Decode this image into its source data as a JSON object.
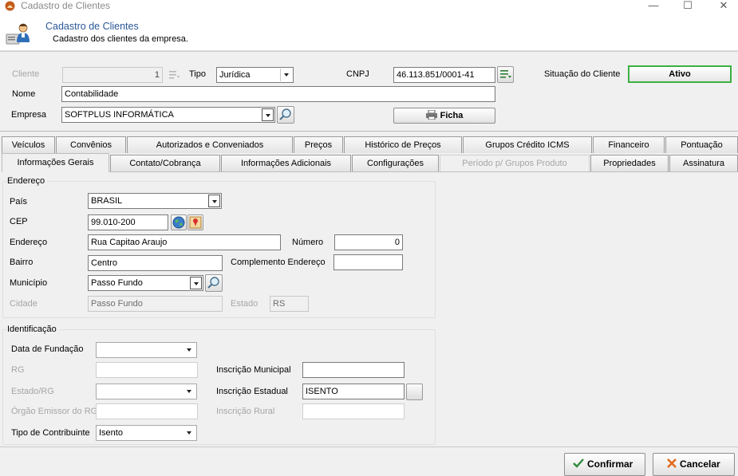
{
  "window": {
    "title": "Cadastro de Clientes",
    "minimize_label": "—",
    "maximize_label": "☐",
    "close_label": "✕"
  },
  "header": {
    "title": "Cadastro de Clientes",
    "subtitle": "Cadastro dos clientes da empresa."
  },
  "form": {
    "cliente_label": "Cliente",
    "cliente_value": "1",
    "tipo_label": "Tipo",
    "tipo_value": "Jurídica",
    "cnpj_label": "CNPJ",
    "cnpj_value": "46.113.851/0001-41",
    "situacao_label": "Situação do Cliente",
    "situacao_value": "Ativo",
    "nome_label": "Nome",
    "nome_value": "Contabilidade",
    "empresa_label": "Empresa",
    "empresa_value": "SOFTPLUS INFORMÁTICA",
    "ficha_label": "Ficha"
  },
  "tabs_row1": [
    "Veículos",
    "Convênios",
    "Autorizados e Conveniados",
    "Preços",
    "Histórico de Preços",
    "Grupos Crédito ICMS",
    "Financeiro",
    "Pontuação"
  ],
  "tabs_row2": [
    "Informações Gerais",
    "Contato/Cobrança",
    "Informações Adicionais",
    "Configurações",
    "Período p/ Grupos Produto",
    "Propriedades",
    "Assinatura"
  ],
  "endereco": {
    "group_label": "Endereço",
    "pais_label": "País",
    "pais_value": "BRASIL",
    "cep_label": "CEP",
    "cep_value": "99.010-200",
    "endereco_label": "Endereço",
    "endereco_value": "Rua Capitao Araujo",
    "numero_label": "Número",
    "numero_value": "0",
    "bairro_label": "Bairro",
    "bairro_value": "Centro",
    "complemento_label": "Complemento Endereço",
    "complemento_value": "",
    "municipio_label": "Município",
    "municipio_value": "Passo Fundo",
    "cidade_label": "Cidade",
    "cidade_value": "Passo Fundo",
    "estado_label": "Estado",
    "estado_value": "RS"
  },
  "identificacao": {
    "group_label": "Identificação",
    "fundacao_label": "Data de Fundação",
    "fundacao_value": "",
    "rg_label": "RG",
    "rg_value": "",
    "insc_municipal_label": "Inscrição Municipal",
    "insc_municipal_value": "",
    "estado_rg_label": "Estado/RG",
    "estado_rg_value": "",
    "insc_estadual_label": "Inscrição Estadual",
    "insc_estadual_value": "ISENTO",
    "orgao_label": "Órgão Emissor do RG",
    "orgao_value": "",
    "insc_rural_label": "Inscrição Rural",
    "insc_rural_value": "",
    "tipo_contrib_label": "Tipo de Contribuinte",
    "tipo_contrib_value": "Isento"
  },
  "footer": {
    "confirmar_label": "Confirmar",
    "cancelar_label": "Cancelar"
  },
  "colors": {
    "header_title": "#2b5797",
    "ativo_border": "#3cb043",
    "confirm_check": "#2e8b3a",
    "cancel_x": "#e36b1f"
  },
  "icons": [
    "app-icon",
    "user-card-icon",
    "list-refresh-icon",
    "search-icon",
    "globe-icon",
    "map-pin-icon",
    "printer-icon",
    "check-icon",
    "cancel-x-icon"
  ]
}
